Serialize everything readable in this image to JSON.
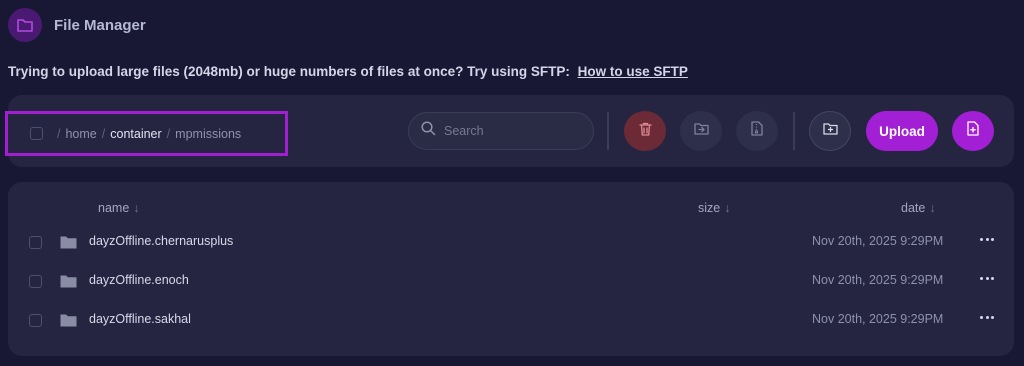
{
  "header": {
    "title": "File Manager",
    "icon": "folder-icon"
  },
  "notice": {
    "text": "Trying to upload large files (2048mb) or huge numbers of files at once? Try using SFTP:",
    "link_label": "How to use SFTP"
  },
  "breadcrumb": {
    "separator": "/",
    "items": [
      "home",
      "container",
      "mpmissions"
    ]
  },
  "search": {
    "placeholder": "Search"
  },
  "toolbar": {
    "upload_label": "Upload",
    "icons": [
      "trash-icon",
      "folder-move-icon",
      "file-archive-icon",
      "folder-plus-icon",
      "file-plus-icon"
    ]
  },
  "table": {
    "columns": [
      {
        "label": "name",
        "sort": "↓"
      },
      {
        "label": "size",
        "sort": "↓"
      },
      {
        "label": "date",
        "sort": "↓"
      }
    ],
    "rows": [
      {
        "name": "dayzOffline.chernarusplus",
        "date": "Nov 20th, 2025 9:29PM"
      },
      {
        "name": "dayzOffline.enoch",
        "date": "Nov 20th, 2025 9:29PM"
      },
      {
        "name": "dayzOffline.sakhal",
        "date": "Nov 20th, 2025 9:29PM"
      }
    ]
  },
  "colors": {
    "background": "#181835",
    "panel": "#252541",
    "accent": "#a21fd6",
    "danger": "#6b2a36",
    "highlight_border": "#a11fd0"
  }
}
